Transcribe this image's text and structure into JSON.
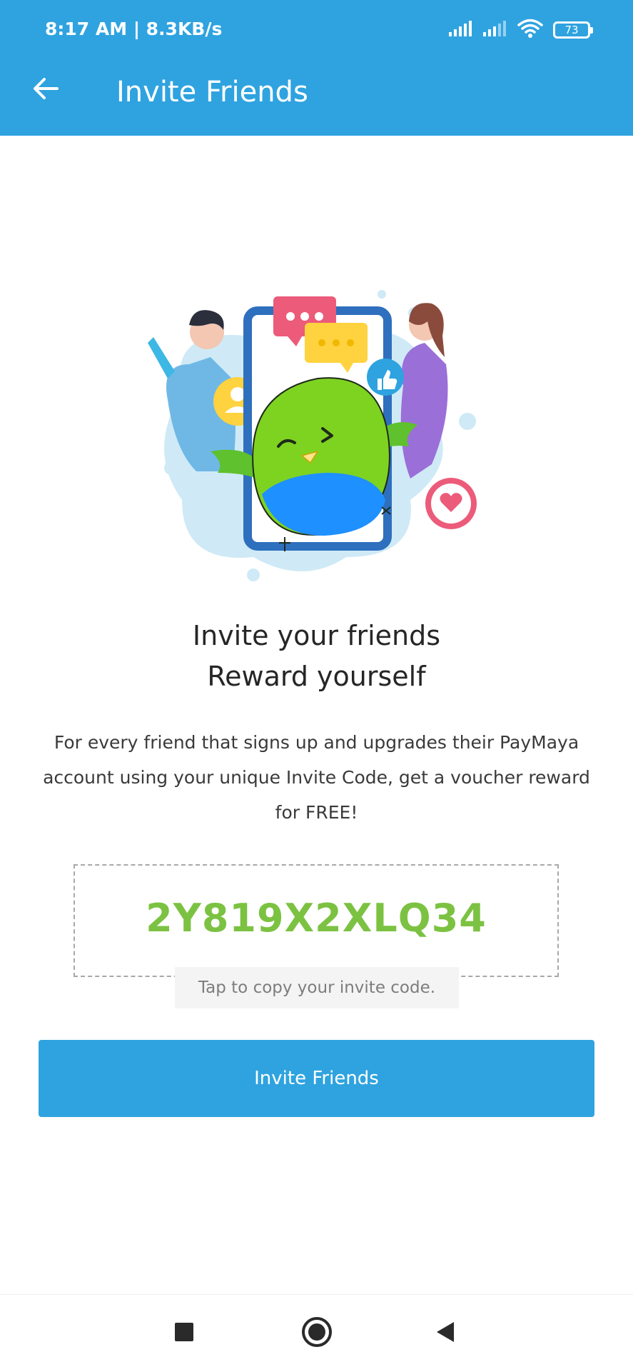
{
  "status_bar": {
    "time_speed": "8:17 AM | 8.3KB/s",
    "battery": "73"
  },
  "header": {
    "title": "Invite Friends",
    "back_icon": "arrow-left-icon"
  },
  "main": {
    "illustration_icon": "invite-friends-illustration",
    "headline_line1": "Invite your friends",
    "headline_line2": "Reward yourself",
    "description": "For every friend that signs up and upgrades their PayMaya account using your unique Invite Code, get a voucher reward for FREE!",
    "invite_code": "2Y819X2XLQ34",
    "copy_hint": "Tap to copy your invite code.",
    "button_label": "Invite Friends"
  },
  "nav": {
    "recents_icon": "square-icon",
    "home_icon": "circle-icon",
    "back_icon": "triangle-back-icon"
  },
  "colors": {
    "brand_blue": "#2fa3e0",
    "code_green": "#7cc242"
  }
}
